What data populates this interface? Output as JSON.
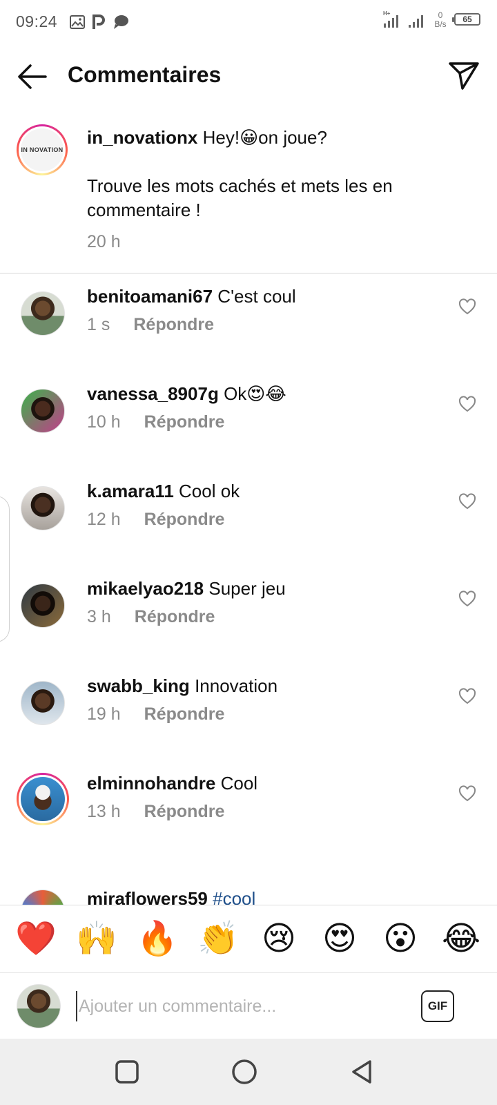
{
  "status_bar": {
    "time": "09:24",
    "net_speed_value": "0",
    "net_speed_unit": "B/s",
    "battery": "65",
    "icons": [
      "image-icon",
      "parking-app-icon",
      "chat-bubble-icon",
      "signal-icon",
      "signal-icon"
    ]
  },
  "header": {
    "title": "Commentaires",
    "back_icon": "arrow-left-icon",
    "send_icon": "paper-plane-icon"
  },
  "caption": {
    "username": "in_novationx",
    "text_before_emoji": "Hey!",
    "emoji": "😀",
    "text_after_emoji": "on joue?",
    "line2": "Trouve les mots cachés et mets les en commentaire !",
    "time": "20 h",
    "avatar_logo_text": "IN NOVATION"
  },
  "reply_label": "Répondre",
  "comments": [
    {
      "username": "benitoamani67",
      "text": "C'est coul",
      "time": "1 s"
    },
    {
      "username": "vanessa_8907g",
      "text": "Ok😍😂",
      "time": "10 h"
    },
    {
      "username": "k.amara11",
      "text": "Cool ok",
      "time": "12 h"
    },
    {
      "username": "mikaelyao218",
      "text": "Super jeu",
      "time": "3 h"
    },
    {
      "username": "swabb_king",
      "text": "Innovation",
      "time": "19 h"
    },
    {
      "username": "elminnohandre",
      "text": "Cool",
      "time": "13 h"
    },
    {
      "username": "miraflowers59",
      "text": "#cool",
      "time": ""
    }
  ],
  "emoji_bar": [
    "❤️",
    "🙌",
    "🔥",
    "👏",
    "😢",
    "😍",
    "😮",
    "😂"
  ],
  "input": {
    "placeholder": "Ajouter un commentaire...",
    "gif_label": "GIF"
  },
  "colors": {
    "accent_gradient": [
      "#d6249f",
      "#fd5949",
      "#fdf497"
    ],
    "meta_gray": "#8a8a8a",
    "hashtag": "#1f4f8a"
  }
}
